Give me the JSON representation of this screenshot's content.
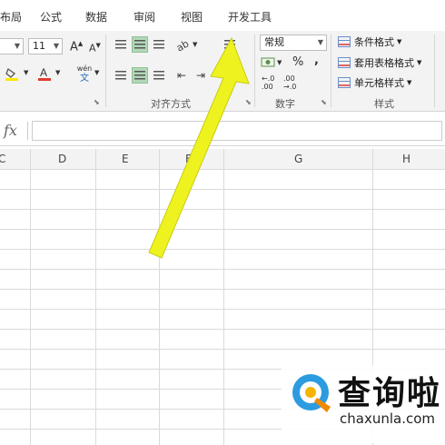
{
  "menu": {
    "items": [
      "布局",
      "公式",
      "数据",
      "审阅",
      "视图",
      "开发工具"
    ]
  },
  "ribbon": {
    "font_size": "11",
    "increase_font": "A",
    "decrease_font": "A",
    "font_color_letter": "A",
    "phonetic_top": "wén",
    "phonetic_bottom": "文",
    "number_format": "常规",
    "percent": "%",
    "comma": ",",
    "decimal_inc": "←.0\n.00",
    "decimal_dec": ".00\n→.0",
    "groups": {
      "alignment": "对齐方式",
      "number": "数字",
      "styles": "样式"
    },
    "styles": {
      "conditional_formatting": "条件格式",
      "format_as_table": "套用表格格式",
      "cell_styles": "单元格样式"
    }
  },
  "formula_bar": {
    "fx": "fx",
    "value": ""
  },
  "columns": [
    "C",
    "D",
    "E",
    "F",
    "G",
    "H"
  ],
  "colors": {
    "highlight_green": "#b2d8b7",
    "arrow_yellow": "#eef21f",
    "font_red": "#e23b2e",
    "fill_yellow": "#ffe600"
  },
  "watermark": {
    "title": "查询啦",
    "domain": "chaxunla.com"
  }
}
